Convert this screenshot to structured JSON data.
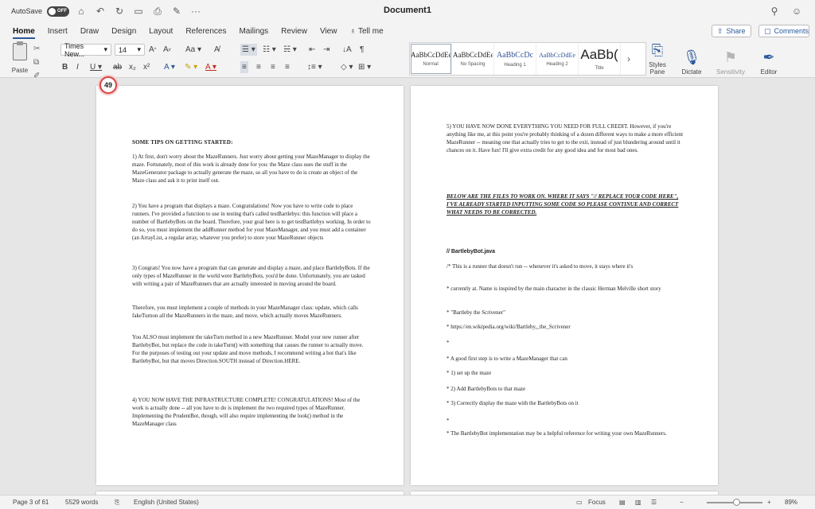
{
  "titlebar": {
    "autosave_label": "AutoSave",
    "autosave_state": "OFF",
    "title": "Document1",
    "more": "···"
  },
  "tabs": [
    {
      "label": "Home"
    },
    {
      "label": "Insert"
    },
    {
      "label": "Draw"
    },
    {
      "label": "Design"
    },
    {
      "label": "Layout"
    },
    {
      "label": "References"
    },
    {
      "label": "Mailings"
    },
    {
      "label": "Review"
    },
    {
      "label": "View"
    },
    {
      "label": "Tell me"
    }
  ],
  "share_label": "Share",
  "comments_label": "Comments",
  "ribbon": {
    "paste_label": "Paste",
    "font_name": "Times New...",
    "font_size": "14",
    "styles": [
      {
        "sample": "AaBbCcDdEe",
        "name": "Normal"
      },
      {
        "sample": "AaBbCcDdEe",
        "name": "No Spacing"
      },
      {
        "sample": "AaBbCcDc",
        "name": "Heading 1"
      },
      {
        "sample": "AaBbCcDdEe",
        "name": "Heading 2"
      },
      {
        "sample": "AaBb(",
        "name": "Title"
      }
    ],
    "styles_pane_label": "Styles\nPane",
    "dictate_label": "Dictate",
    "sensitivity_label": "Sensitivity",
    "editor_label": "Editor"
  },
  "zoom_badge": "49",
  "page1": {
    "heading": "SOME TIPS ON GETTING STARTED:",
    "para1": "1) At first, don't worry about the MazeRunners. Just worry about getting your MazeManager to display the maze. Fortunately, most of this work is already done for you: the Maze class uses the stuff in the MazeGenerator package to actually generate the maze, so all you have to do is create an object of the Maze class and ask it to print itself out.",
    "para2": "2) You have a program that displays a maze. Congratulations! Now you have to write code to place runners. I've provided a function to use in testing that's called testBartlebys: this function will place a number of BartlebyBots on the board. Therefore, your goal here is to get testBartlebys working. In order to do so, you must implement the addRunner method for your MazeManager, and you must add a container (an ArrayList, a regular array, whatever you prefer) to store your MazeRunner objects",
    "para3": "3) Congrats! You now have a program that can generate and display a maze, and place BartlebyBots. If the only types of MazeRunner in the world were BartlebyBots, you'd be done. Unfortunately, you are tasked with writing a pair of MazeRunners that are actually interested in moving around the board.",
    "para4": "Therefore, you must implement a couple of methods in your MazeManager class: update, which calls fakeTurnon all the MazeRunners in the maze, and move, which actually moves MazeRunners.",
    "para5": "You ALSO must implement the takeTurn method in a new MazeRunner. Model your new runner after BartlebyBot, but replace the code in takeTurn() with something that causes the runner to actually move. For the purposes of testing out your update and move methods, I recommend writing a bot that's like BartlebyBot, but that moves Direction.SOUTH instead of Direction.HERE.",
    "para6": "4) YOU NOW HAVE THE INFRASTRUCTURE COMPLETE! CONGRATULATIONS! Most of the work is actually done -- all you have to do is implement the two required types of MazeRunner. Implementing the PrudentBot, though, will also require implementing the look() method in the MazeManager class"
  },
  "page2": {
    "para1": "5) YOU HAVE NOW DONE EVERYTHING YOU NEED FOR FULL CREDIT. However, if you're anything like me, at this point you're probably thinking of a dozen different ways to make a more efficient MazeRunner -- meaning one that actually tries to get to the exit, instead of just blundering around until it chances on it. Have fun! I'll give extra credit for any good idea and for most bad ones.",
    "para2": "BELOW ARE THE FILES TO WORK ON. WHERE IT SAYS \"// REPLACE YOUR CODE HERE\", I'VE ALREADY STARTED INPUTTING SOME CODE SO PLEASE CONTINUE AND CORRECT WHAT NEEDS TO BE CORRECTED.",
    "file_head": "// BartlebyBot.java",
    "line1": "/* This is a runner that doesn't run -- whenever it's asked to move, it stays where it's",
    "line2": "* currently at. Name is inspired by the main character in the classic Herman Melville short story",
    "line3": "* \"Bartleby the Scrivener\"",
    "line4": "* https://en.wikipedia.org/wiki/Bartleby,_the_Scrivener",
    "line5": "*",
    "line6": "* A good first step is to write a MazeManager that can",
    "line7": "* 1) set up the maze",
    "line8": "* 2) Add BartlebyBots to that maze",
    "line9": "* 3) Correctly display the maze with the BartlebyBots on it",
    "line10": "*",
    "line11": "* The BartlebyBot implementation may be a helpful reference for writing your own MazeRunners."
  },
  "status": {
    "page": "Page 3 of 61",
    "words": "5529 words",
    "language": "English (United States)",
    "focus": "Focus",
    "zoom": "89%"
  }
}
